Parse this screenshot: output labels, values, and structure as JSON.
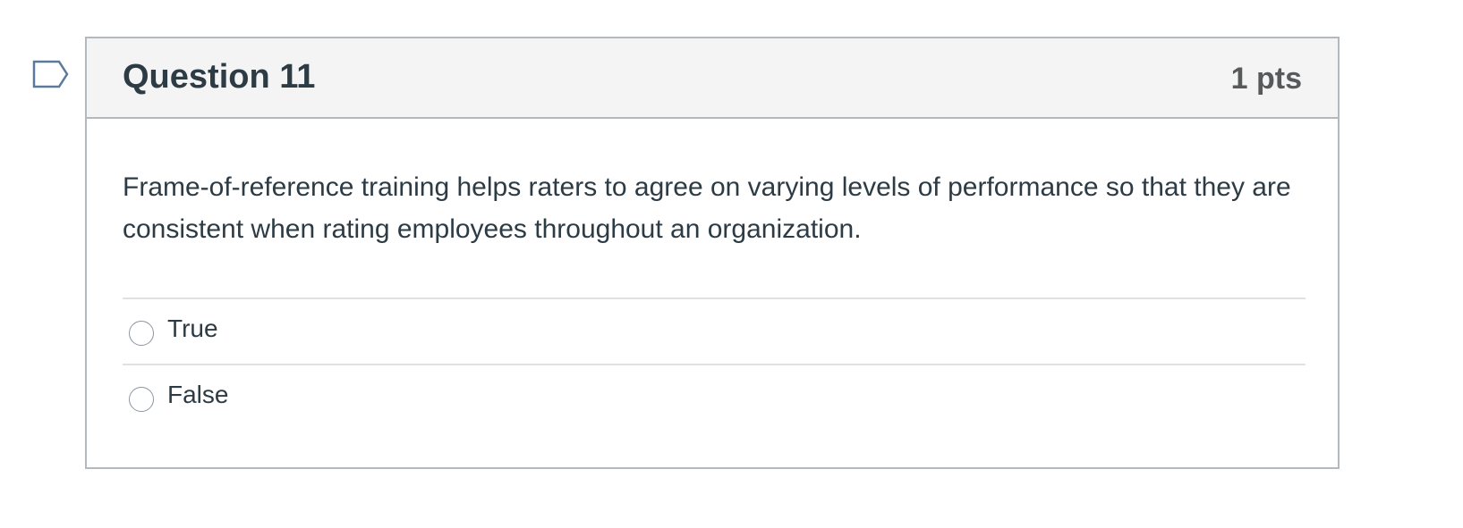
{
  "question": {
    "title": "Question 11",
    "points": "1 pts",
    "text": "Frame-of-reference training helps raters to agree on varying levels of performance so that they are consistent when rating employees throughout an organization.",
    "answers": [
      {
        "label": "True",
        "selected": false
      },
      {
        "label": "False",
        "selected": false
      }
    ]
  },
  "flag": {
    "icon": "bookmark-flag-icon",
    "color": "#5a7a9c"
  },
  "colors": {
    "header_bg": "#f4f4f4",
    "border": "#b4b9bd",
    "text": "#2d3b45",
    "points": "#58595b"
  }
}
